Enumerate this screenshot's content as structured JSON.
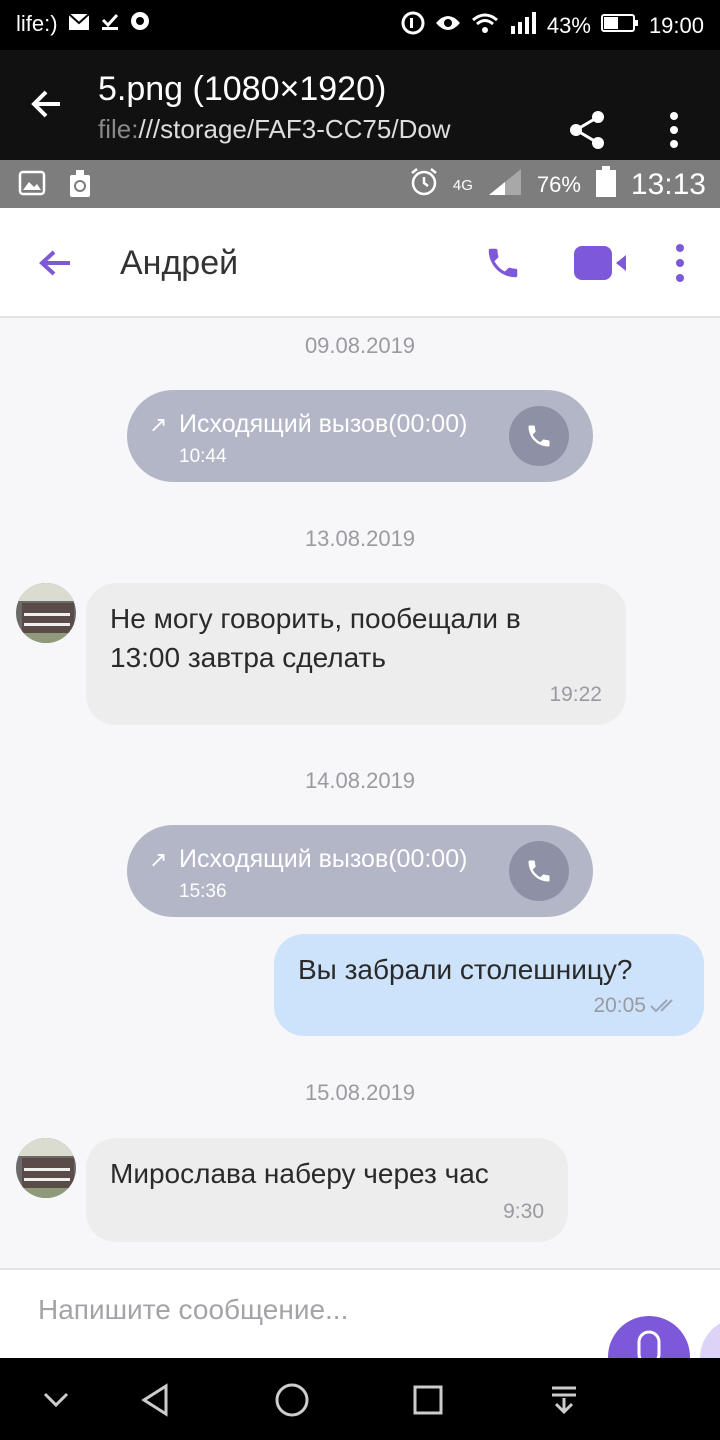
{
  "outer_status": {
    "carrier": "life:)",
    "battery": "43%",
    "time": "19:00",
    "icons": [
      "mail-icon",
      "download-done-icon",
      "chrome-icon",
      "data-saver-icon",
      "eye-icon",
      "wifi-icon",
      "signal-icon",
      "battery-icon"
    ]
  },
  "viewer": {
    "title": "5.png (1080×1920)",
    "path_prefix": "file:",
    "path_rest": "///storage/FAF3-CC75/Dow",
    "icons": [
      "back-arrow-icon",
      "share-icon",
      "more-vert-icon"
    ]
  },
  "inner_status": {
    "network": "4G",
    "battery": "76%",
    "time": "13:13",
    "icons": [
      "gallery-icon",
      "cleaner-icon",
      "alarm-icon",
      "signal-icon",
      "battery-icon"
    ]
  },
  "chat": {
    "contact_name": "Андрей",
    "accent": "#7d58d9",
    "composer_placeholder": "Напишите сообщение...",
    "dates": [
      "09.08.2019",
      "13.08.2019",
      "14.08.2019",
      "15.08.2019"
    ],
    "calls": [
      {
        "label": "Исходящий вызов(00:00)",
        "time": "10:44"
      },
      {
        "label": "Исходящий вызов(00:00)",
        "time": "15:36"
      }
    ],
    "messages": [
      {
        "line1": "Не могу говорить, пообещали в",
        "line2": "13:00 завтра сделать",
        "time": "19:22"
      },
      {
        "text": "Вы забрали столешницу?",
        "time": "20:05"
      },
      {
        "text": "Мирослава наберу через час",
        "time": "9:30"
      }
    ]
  }
}
